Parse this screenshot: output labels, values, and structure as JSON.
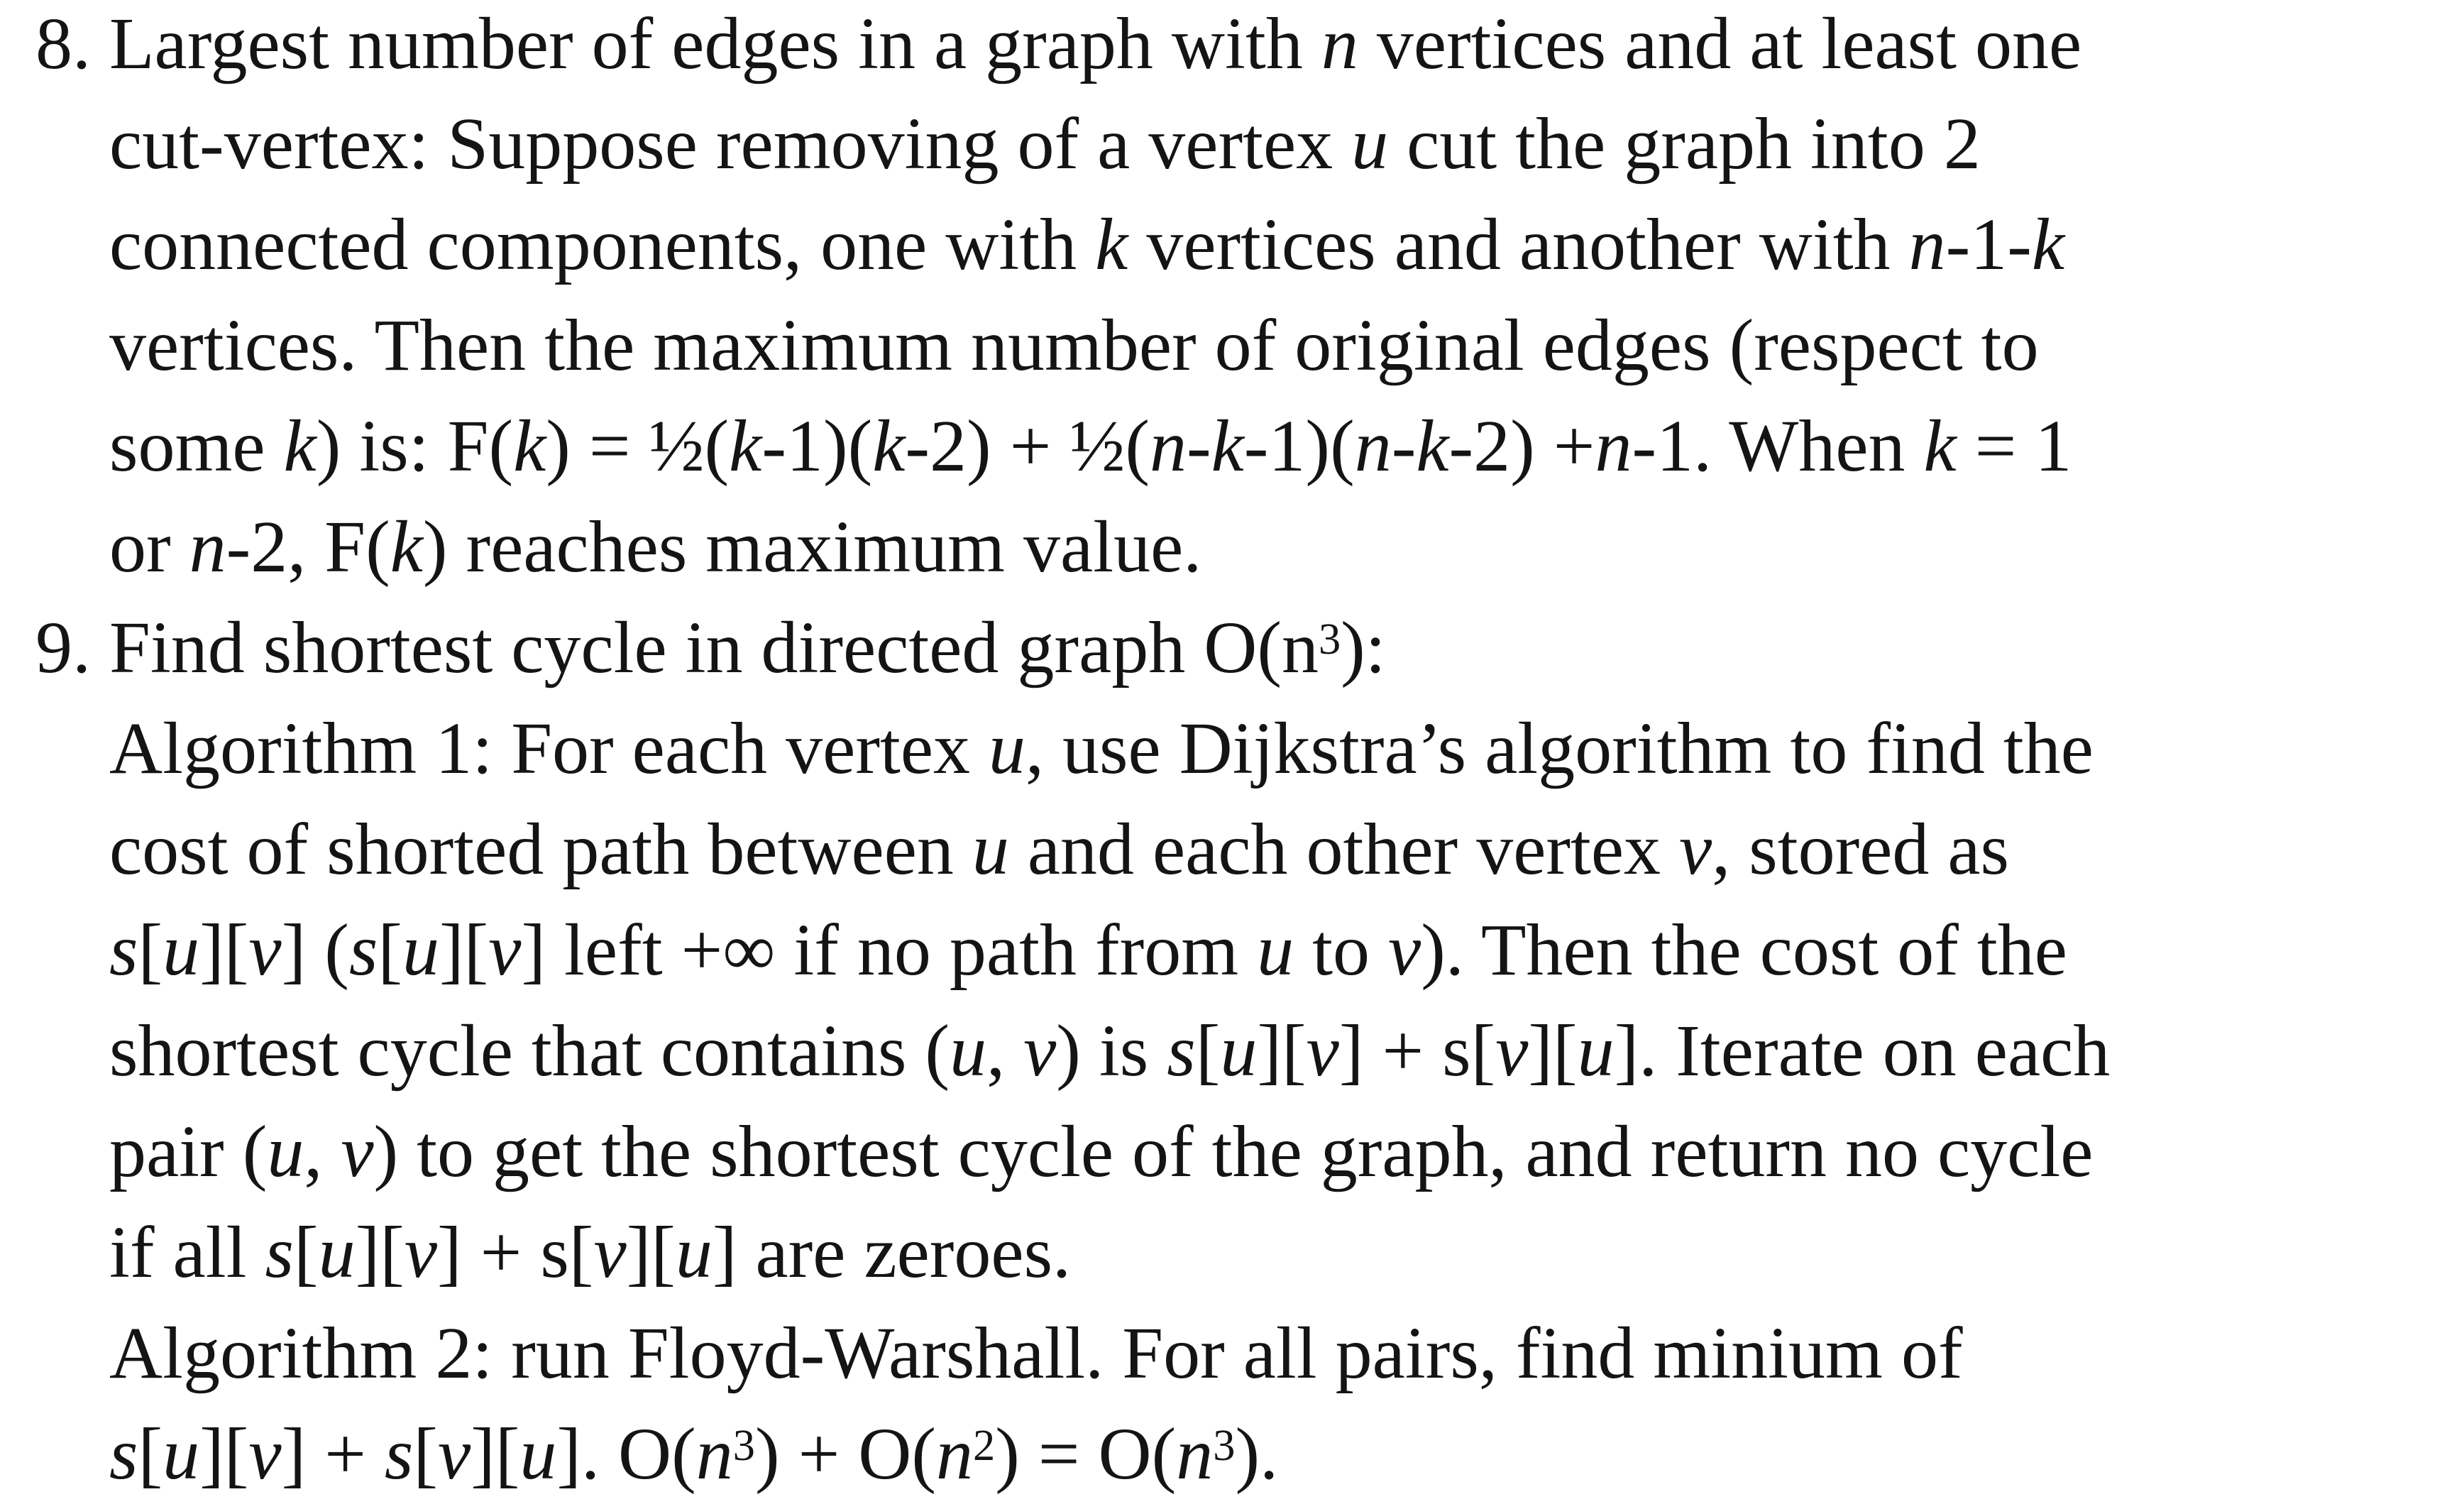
{
  "item8": {
    "number": "8.",
    "lines": [
      [
        {
          "t": "Largest number of edges in a graph with "
        },
        {
          "t": "n",
          "i": true
        },
        {
          "t": " vertices and at least one"
        }
      ],
      [
        {
          "t": "cut-vertex: Suppose removing of a vertex "
        },
        {
          "t": "u",
          "i": true
        },
        {
          "t": " cut the graph into 2"
        }
      ],
      [
        {
          "t": "connected components, one with "
        },
        {
          "t": "k",
          "i": true
        },
        {
          "t": " vertices and another with "
        },
        {
          "t": "n",
          "i": true
        },
        {
          "t": "-1-"
        },
        {
          "t": "k",
          "i": true
        }
      ],
      [
        {
          "t": "vertices. Then the maximum number of original edges (respect to"
        }
      ],
      [
        {
          "t": "some "
        },
        {
          "t": "k",
          "i": true
        },
        {
          "t": ") is: F("
        },
        {
          "t": "k",
          "i": true
        },
        {
          "t": ") = ½("
        },
        {
          "t": "k",
          "i": true
        },
        {
          "t": "-1)("
        },
        {
          "t": "k",
          "i": true
        },
        {
          "t": "-2) + ½("
        },
        {
          "t": "n",
          "i": true
        },
        {
          "t": "-"
        },
        {
          "t": "k",
          "i": true
        },
        {
          "t": "-1)("
        },
        {
          "t": "n",
          "i": true
        },
        {
          "t": "-"
        },
        {
          "t": "k",
          "i": true
        },
        {
          "t": "-2) +"
        },
        {
          "t": "n",
          "i": true
        },
        {
          "t": "-1. When "
        },
        {
          "t": "k",
          "i": true
        },
        {
          "t": " = 1"
        }
      ],
      [
        {
          "t": "or "
        },
        {
          "t": "n",
          "i": true
        },
        {
          "t": "-2, F("
        },
        {
          "t": "k",
          "i": true
        },
        {
          "t": ") reaches maximum value."
        }
      ]
    ]
  },
  "item9": {
    "number": "9.",
    "lines": [
      [
        {
          "t": "Find shortest cycle in directed graph O(n"
        },
        {
          "t": "3",
          "sup": true
        },
        {
          "t": "):"
        }
      ],
      [
        {
          "t": "Algorithm 1: For each vertex "
        },
        {
          "t": "u",
          "i": true
        },
        {
          "t": ", use Dijkstra’s algorithm to find the"
        }
      ],
      [
        {
          "t": "cost of shorted path between "
        },
        {
          "t": "u",
          "i": true
        },
        {
          "t": " and each other vertex "
        },
        {
          "t": "v",
          "i": true
        },
        {
          "t": ", stored as"
        }
      ],
      [
        {
          "t": "s",
          "i": true
        },
        {
          "t": "["
        },
        {
          "t": "u",
          "i": true
        },
        {
          "t": "]["
        },
        {
          "t": "v",
          "i": true
        },
        {
          "t": "] ("
        },
        {
          "t": "s",
          "i": true
        },
        {
          "t": "["
        },
        {
          "t": "u",
          "i": true
        },
        {
          "t": "]["
        },
        {
          "t": "v",
          "i": true
        },
        {
          "t": "] left +∞ if no path from "
        },
        {
          "t": "u",
          "i": true
        },
        {
          "t": " to "
        },
        {
          "t": "v",
          "i": true
        },
        {
          "t": "). Then the cost of the"
        }
      ],
      [
        {
          "t": "shortest cycle that contains ("
        },
        {
          "t": "u",
          "i": true
        },
        {
          "t": ", "
        },
        {
          "t": "v",
          "i": true
        },
        {
          "t": ") is "
        },
        {
          "t": "s",
          "i": true
        },
        {
          "t": "["
        },
        {
          "t": "u",
          "i": true
        },
        {
          "t": "]["
        },
        {
          "t": "v",
          "i": true
        },
        {
          "t": "] + s["
        },
        {
          "t": "v",
          "i": true
        },
        {
          "t": "]["
        },
        {
          "t": "u",
          "i": true
        },
        {
          "t": "]. Iterate on each"
        }
      ],
      [
        {
          "t": "pair ("
        },
        {
          "t": "u",
          "i": true
        },
        {
          "t": ", "
        },
        {
          "t": "v",
          "i": true
        },
        {
          "t": ") to get the shortest cycle of the graph, and return no cycle"
        }
      ],
      [
        {
          "t": "if all "
        },
        {
          "t": "s",
          "i": true
        },
        {
          "t": "["
        },
        {
          "t": "u",
          "i": true
        },
        {
          "t": "]["
        },
        {
          "t": "v",
          "i": true
        },
        {
          "t": "] + s["
        },
        {
          "t": "v",
          "i": true
        },
        {
          "t": "]["
        },
        {
          "t": "u",
          "i": true
        },
        {
          "t": "] are zeroes."
        }
      ],
      [
        {
          "t": "Algorithm 2:  run Floyd-Warshall. For all pairs, find minium of"
        }
      ],
      [
        {
          "t": "s",
          "i": true
        },
        {
          "t": "["
        },
        {
          "t": "u",
          "i": true
        },
        {
          "t": "]["
        },
        {
          "t": "v",
          "i": true
        },
        {
          "t": "] + "
        },
        {
          "t": "s",
          "i": true
        },
        {
          "t": "["
        },
        {
          "t": "v",
          "i": true
        },
        {
          "t": "]["
        },
        {
          "t": "u",
          "i": true
        },
        {
          "t": "]. O("
        },
        {
          "t": "n",
          "i": true
        },
        {
          "t": "3",
          "sup": true
        },
        {
          "t": ") + O("
        },
        {
          "t": "n",
          "i": true
        },
        {
          "t": "2",
          "sup": true
        },
        {
          "t": ") = O("
        },
        {
          "t": "n",
          "i": true
        },
        {
          "t": "3",
          "sup": true
        },
        {
          "t": ")."
        }
      ]
    ]
  }
}
